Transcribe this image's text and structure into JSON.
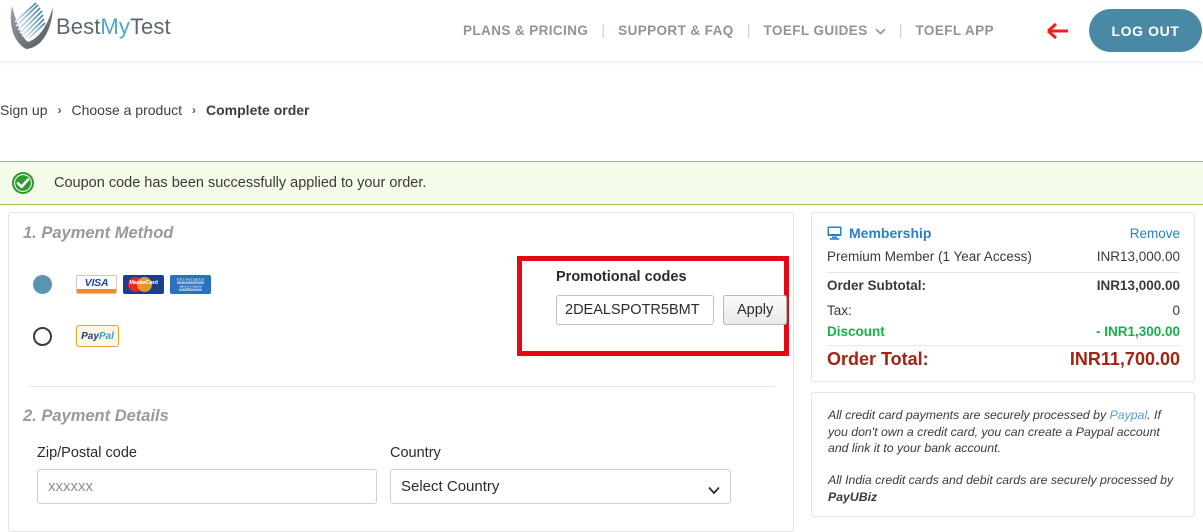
{
  "brand": {
    "name_part1": "Best",
    "name_part2": "My",
    "name_part3": "Test",
    "logo_icon": "checkmark-swoosh-logo"
  },
  "header": {
    "nav_items": [
      {
        "label": "PLANS & PRICING",
        "has_chevron": false
      },
      {
        "label": "SUPPORT & FAQ",
        "has_chevron": false
      },
      {
        "label": "TOEFL GUIDES",
        "has_chevron": true
      },
      {
        "label": "TOEFL APP",
        "has_chevron": false
      }
    ],
    "separator": "|",
    "annotation_icon": "red-left-arrow",
    "logout_label": "LOG OUT",
    "logout_color": "#4a89a5"
  },
  "breadcrumb": {
    "items": [
      "Sign up",
      "Choose a product",
      "Complete order"
    ],
    "separator": "›",
    "current_index": 2
  },
  "alert": {
    "icon": "green-check-circle-icon",
    "message": "Coupon code has been successfully applied to your order.",
    "background": "#f4fbe9",
    "border_color": "#93c948"
  },
  "payment_method": {
    "section_title": "1. Payment Method",
    "options": [
      {
        "id": "credit-card",
        "selected": true,
        "logos": [
          "VISA",
          "MasterCard",
          "AMERICAN EXPRESS"
        ]
      },
      {
        "id": "paypal",
        "selected": false,
        "logo_text_1": "Pay",
        "logo_text_2": "Pal"
      }
    ]
  },
  "promo": {
    "label": "Promotional codes",
    "code_value": "2DEALSPOTR5BMT",
    "code_placeholder": "",
    "apply_label": "Apply",
    "highlight_color": "#e50914"
  },
  "payment_details": {
    "section_title": "2. Payment Details",
    "zip": {
      "label": "Zip/Postal code",
      "value": "",
      "placeholder": "xxxxxx"
    },
    "country": {
      "label": "Country",
      "selected": "Select Country",
      "options": [
        "Select Country"
      ]
    }
  },
  "order_summary": {
    "icon": "monitor-icon",
    "title": "Membership",
    "remove_label": "Remove",
    "item_name": "Premium Member (1 Year Access)",
    "item_price": "INR13,000.00",
    "subtotal_label": "Order Subtotal:",
    "subtotal_value": "INR13,000.00",
    "tax_label": "Tax:",
    "tax_value": "0",
    "discount_label": "Discount",
    "discount_value": "- INR1,300.00",
    "discount_color": "#14b14b",
    "total_label": "Order Total:",
    "total_value": "INR11,700.00",
    "total_color": "#a32314"
  },
  "notes": {
    "paragraph1_a": "All credit card payments are securely processed by ",
    "paragraph1_link": "Paypal",
    "paragraph1_b": ". If you don't own a credit card, you can create a Paypal account and link it to your bank account.",
    "paragraph2": "All India credit cards and debit cards are securely processed by ",
    "paragraph2_bold": "PayUBiz"
  }
}
